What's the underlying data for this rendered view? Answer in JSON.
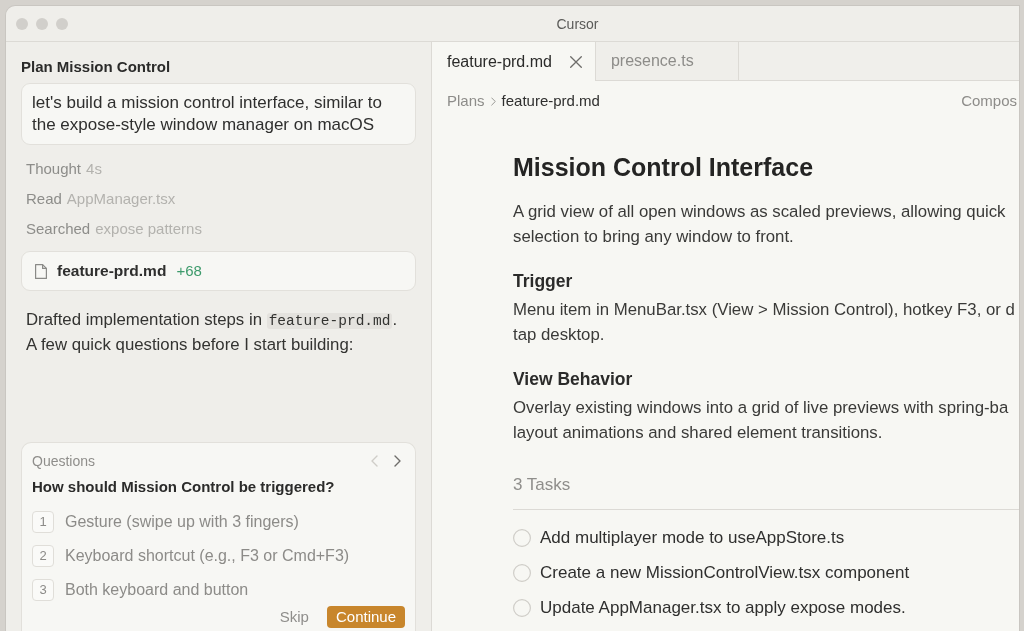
{
  "window": {
    "title": "Cursor"
  },
  "chat": {
    "title": "Plan Mission Control",
    "prompt": "let's build a mission control interface, similar to the expose-style window manager on macOS",
    "steps": [
      {
        "action": "Thought",
        "detail": "4s"
      },
      {
        "action": "Read",
        "detail": "AppManager.tsx"
      },
      {
        "action": "Searched",
        "detail": "expose patterns"
      }
    ],
    "file_card": {
      "name": "feature-prd.md",
      "additions": "+68"
    },
    "message": [
      {
        "kind": "text",
        "text": "Drafted implementation steps in "
      },
      {
        "kind": "code",
        "text": "feature-prd.md"
      },
      {
        "kind": "text",
        "text": ".\nA few quick questions before I start building:"
      }
    ],
    "questions": {
      "label": "Questions",
      "pager": [
        {
          "kind": "prev",
          "disabled": true
        },
        {
          "kind": "next",
          "disabled": false
        }
      ],
      "question": "How should Mission Control be triggered?",
      "options": [
        {
          "key": "1",
          "text": "Gesture (swipe up with 3 fingers)"
        },
        {
          "key": "2",
          "text": "Keyboard shortcut (e.g., F3 or Cmd+F3)"
        },
        {
          "key": "3",
          "text": "Both keyboard and button"
        }
      ],
      "actions": [
        {
          "kind": "secondary",
          "label": "Skip"
        },
        {
          "kind": "primary",
          "label": "Continue"
        }
      ]
    }
  },
  "editor": {
    "tabs": [
      {
        "label": "feature-prd.md",
        "selected": true
      },
      {
        "label": "presence.ts",
        "selected": false
      }
    ],
    "breadcrumb": [
      "Plans",
      "feature-prd.md"
    ],
    "right_label": "Compos",
    "document": {
      "title": "Mission Control Interface",
      "intro": "A grid view of all open windows as scaled previews, allowing quick\nselection to bring any window to front.",
      "sections": [
        {
          "heading": "Trigger",
          "text": "Menu item in MenuBar.tsx (View > Mission Control), hotkey F3, or d\ntap desktop."
        },
        {
          "heading": "View Behavior",
          "text": "Overlay existing windows into a grid of live previews with spring-ba\nlayout animations and shared element transitions."
        }
      ],
      "tasks_label": "3 Tasks",
      "tasks": [
        {
          "text": "Add multiplayer mode to useAppStore.ts",
          "checked": false
        },
        {
          "text": "Create a new MissionControlView.tsx component",
          "checked": false
        },
        {
          "text": "Update AppManager.tsx to apply expose modes.",
          "checked": false
        }
      ]
    }
  }
}
